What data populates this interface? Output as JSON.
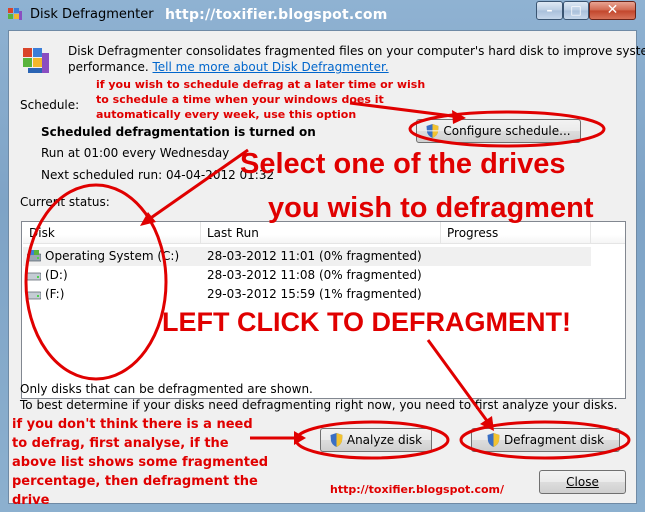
{
  "window": {
    "title": "Disk Defragmenter",
    "title_url_overlay": "http://toxifier.blogspot.com"
  },
  "intro": {
    "description": "Disk Defragmenter consolidates fragmented files on your computer's hard disk to improve system",
    "description2": "performance.",
    "link": "Tell me more about Disk Defragmenter."
  },
  "schedule": {
    "label": "Schedule:",
    "status": "Scheduled defragmentation is turned on",
    "run_at": "Run at 01:00 every Wednesday",
    "next_run": "Next scheduled run: 04-04-2012 01:32",
    "configure_button": "Configure schedule..."
  },
  "current_status": {
    "label": "Current status:",
    "columns": [
      "Disk",
      "Last Run",
      "Progress"
    ],
    "rows": [
      {
        "disk": "Operating System (C:)",
        "last_run": "28-03-2012 11:01 (0% fragmented)",
        "progress": ""
      },
      {
        "disk": "(D:)",
        "last_run": "28-03-2012 11:08 (0% fragmented)",
        "progress": ""
      },
      {
        "disk": "(F:)",
        "last_run": "29-03-2012 15:59 (1% fragmented)",
        "progress": ""
      }
    ]
  },
  "footer": {
    "note1": "Only disks that can be defragmented are shown.",
    "note2": "To best determine if your disks need defragmenting right now, you need to first analyze your disks.",
    "analyze_button": "Analyze disk",
    "defragment_button": "Defragment disk",
    "close_button": "Close"
  },
  "annotations": {
    "schedule_note": [
      "if you wish to schedule defrag at a later time or wish",
      "to schedule a time when your windows does it",
      "automatically every week, use this option"
    ],
    "select_drive": [
      "Select one of the drives",
      "you wish to defragment"
    ],
    "left_click": "LEFT CLICK TO DEFRAGMENT!",
    "analyse_note": [
      "if you don't think there is a need",
      "to defrag, first analyse, if the",
      "above list shows some fragmented",
      "percentage, then defragment  the",
      "drive"
    ],
    "bottom_url": "http://toxifier.blogspot.com/",
    "color": "#e00000"
  }
}
